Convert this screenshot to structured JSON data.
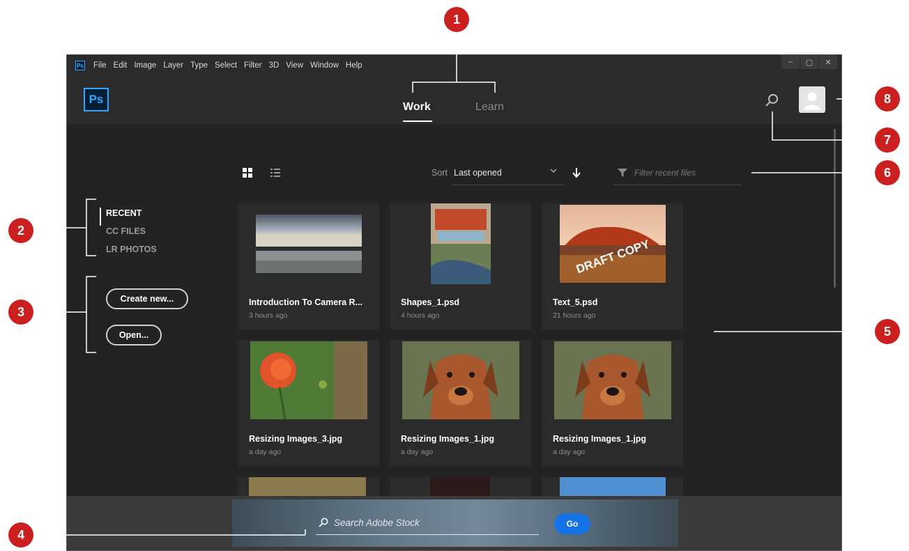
{
  "menubar": {
    "app_badge": "Ps",
    "items": [
      "File",
      "Edit",
      "Image",
      "Layer",
      "Type",
      "Select",
      "Filter",
      "3D",
      "View",
      "Window",
      "Help"
    ],
    "controls": [
      "–",
      "▢",
      "✕"
    ]
  },
  "header": {
    "logo": "Ps",
    "tabs": {
      "work": "Work",
      "learn": "Learn"
    },
    "search_icon": "search-icon",
    "avatar_icon": "user-avatar-icon"
  },
  "sidebar": {
    "nav": [
      "RECENT",
      "CC FILES",
      "LR PHOTOS"
    ],
    "active": "RECENT",
    "create_button": "Create new...",
    "open_button": "Open..."
  },
  "toolbar": {
    "view_modes": [
      "grid-view-icon",
      "list-view-icon"
    ],
    "sort_label": "Sort",
    "sort_value": "Last opened",
    "filter_placeholder": "Filter recent files"
  },
  "files": [
    {
      "name": "Introduction To Camera R...",
      "time": "3 hours ago",
      "thumb": "seascape"
    },
    {
      "name": "Shapes_1.psd",
      "time": "4 hours ago",
      "thumb": "poster"
    },
    {
      "name": "Text_5.psd",
      "time": "21 hours ago",
      "thumb": "uluru",
      "overlay": "DRAFT COPY"
    },
    {
      "name": "Resizing Images_3.jpg",
      "time": "a day ago",
      "thumb": "poppy"
    },
    {
      "name": "Resizing Images_1.jpg",
      "time": "a day ago",
      "thumb": "dog"
    },
    {
      "name": "Resizing Images_1.jpg",
      "time": "a day ago",
      "thumb": "dog"
    }
  ],
  "stock": {
    "placeholder": "Search Adobe Stock",
    "go": "Go"
  },
  "callouts": [
    "1",
    "2",
    "3",
    "4",
    "5",
    "6",
    "7",
    "8"
  ],
  "colors": {
    "accent": "#31a8ff",
    "callout": "#cc1f1f",
    "go_button": "#1473e6",
    "window_bg": "#232323"
  }
}
